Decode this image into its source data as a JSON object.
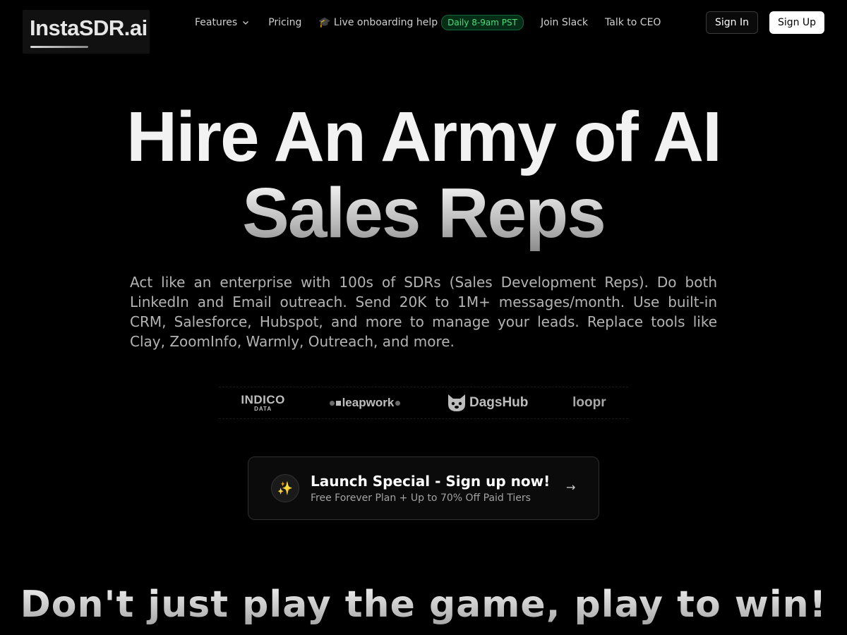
{
  "nav": {
    "logo": "InstaSDR.ai",
    "features": "Features",
    "pricing": "Pricing",
    "live_help_icon": "🎓",
    "live_help": "Live onboarding help",
    "live_badge": "Daily 8-9am PST",
    "join_slack": "Join Slack",
    "talk_ceo": "Talk to CEO",
    "sign_in": "Sign In",
    "sign_up": "Sign Up"
  },
  "hero": {
    "title_line1": "Hire An Army of AI",
    "title_line2": "Sales Reps",
    "description": "Act like an enterprise with 100s of SDRs (Sales Development Reps). Do both LinkedIn and Email outreach. Send 20K to 1M+ messages/month. Use built-in CRM, Salesforce, Hubspot, and more to manage your leads. Replace tools like Clay, ZoomInfo, Warmly, Outreach, and more."
  },
  "logos": {
    "indico_top": "INDICO",
    "indico_bottom": "DATA",
    "leapwork": "leapwork",
    "dagshub": "DagsHub",
    "loopr": "loopr"
  },
  "cta": {
    "icon": "✨",
    "title": "Launch Special - Sign up now!",
    "subtitle": "Free Forever Plan + Up to 70% Off Paid Tiers",
    "arrow": "→"
  },
  "section2": {
    "heading": "Don't just play the game, play to win!"
  },
  "colors": {
    "background": "#000000",
    "badge_green": "#4ade80",
    "text_muted": "#b3b3b3"
  }
}
